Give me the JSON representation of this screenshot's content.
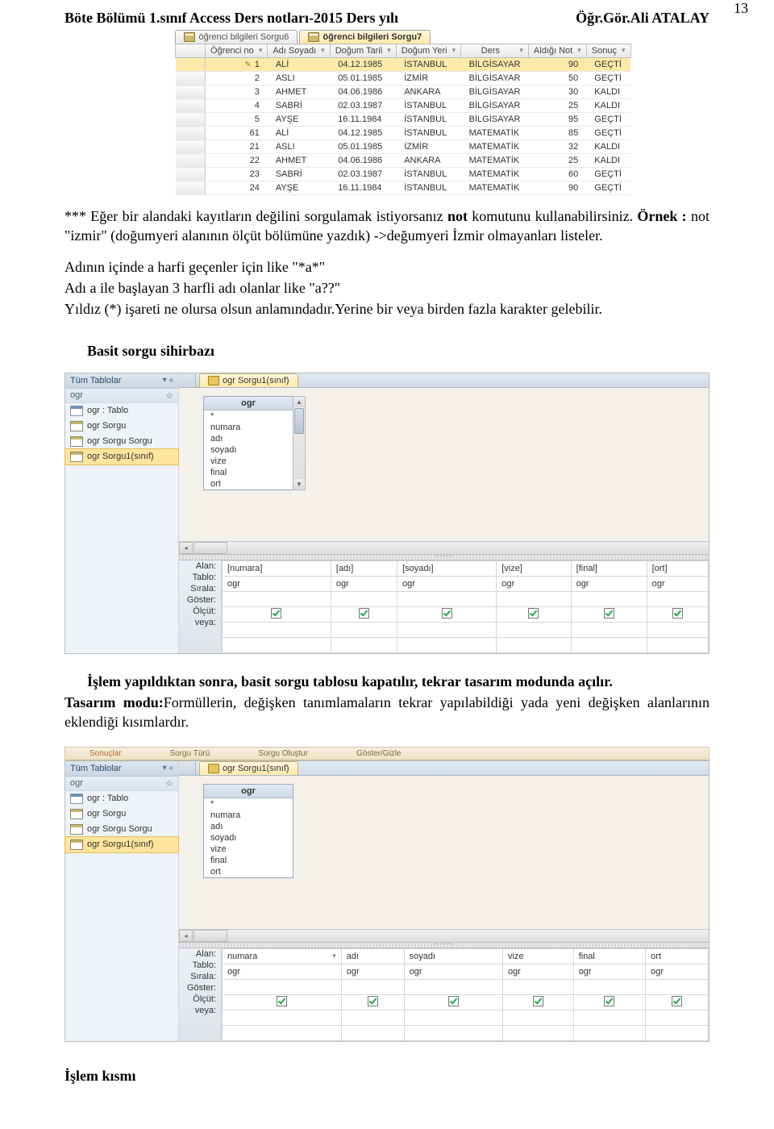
{
  "page_number": "13",
  "header_left": "Böte Bölümü 1.sınıf Access Ders notları-2015 Ders yılı",
  "header_right": "Öğr.Gör.Ali ATALAY",
  "query_tabs": [
    "öğrenci bilgileri Sorgu6",
    "öğrenci bilgileri Sorgu7"
  ],
  "qres_headers": [
    "Öğrenci no",
    "Adı Soyadı",
    "Doğum Taril",
    "Doğum Yeri",
    "Ders",
    "Aldığı Not",
    "Sonuç"
  ],
  "qres_rows": [
    [
      "1",
      "ALİ",
      "04.12.1985",
      "İSTANBUL",
      "BİLGİSAYAR",
      "90",
      "GEÇTİ"
    ],
    [
      "2",
      "ASLI",
      "05.01.1985",
      "İZMİR",
      "BİLGİSAYAR",
      "50",
      "GEÇTİ"
    ],
    [
      "3",
      "AHMET",
      "04.06.1986",
      "ANKARA",
      "BİLGİSAYAR",
      "30",
      "KALDI"
    ],
    [
      "4",
      "SABRİ",
      "02.03.1987",
      "İSTANBUL",
      "BİLGİSAYAR",
      "25",
      "KALDI"
    ],
    [
      "5",
      "AYŞE",
      "16.11.1984",
      "İSTANBUL",
      "BİLGİSAYAR",
      "95",
      "GEÇTİ"
    ],
    [
      "61",
      "ALİ",
      "04.12.1985",
      "İSTANBUL",
      "MATEMATİK",
      "85",
      "GEÇTİ"
    ],
    [
      "21",
      "ASLI",
      "05.01.1985",
      "İZMİR",
      "MATEMATİK",
      "32",
      "KALDI"
    ],
    [
      "22",
      "AHMET",
      "04.06.1986",
      "ANKARA",
      "MATEMATİK",
      "25",
      "KALDI"
    ],
    [
      "23",
      "SABRİ",
      "02.03.1987",
      "İSTANBUL",
      "MATEMATİK",
      "60",
      "GEÇTİ"
    ],
    [
      "24",
      "AYŞE",
      "16.11.1984",
      "İSTANBUL",
      "MATEMATİK",
      "90",
      "GEÇTİ"
    ]
  ],
  "para1": "*** Eğer bir alandaki kayıtların değilini sorgulamak istiyorsanız ",
  "para1_bold": "not",
  "para1b": " komutunu kullanabilirsiniz. ",
  "para1_bold2": "Örnek :",
  "para1c": " not \"izmir\" (doğumyeri alanının ölçüt  bölümüne yazdık) ->değumyeri İzmir olmayanları listeler.",
  "para2": "Adının içinde a harfi geçenler için like \"*a*\"",
  "para3": "Adı a ile başlayan 3 harfli adı olanlar   like \"a??\"",
  "para4": "Yıldız (*) işareti ne olursa olsun anlamındadır.Yerine bir veya birden fazla karakter gelebilir.",
  "heading_basit": "Basit sorgu sihirbazı",
  "nav_title": "Tüm Tablolar",
  "nav_group": "ogr",
  "nav_items": [
    "ogr : Tablo",
    "ogr Sorgu",
    "ogr Sorgu Sorgu",
    "ogr Sorgu1(sınıf)"
  ],
  "query_tab_design": "ogr Sorgu1(sınıf)",
  "tbl_box_title": "ogr",
  "tbl_box_fields": [
    "*",
    "numara",
    "adı",
    "soyadı",
    "vize",
    "final",
    "ort"
  ],
  "grid_labels": [
    "Alan:",
    "Tablo:",
    "Sırala:",
    "Göster:",
    "Ölçüt:",
    "veya:"
  ],
  "grid1_alan": [
    "[numara]",
    "[adı]",
    "[soyadı]",
    "[vize]",
    "[final]",
    "[ort]"
  ],
  "grid2_alan": [
    "numara",
    "adı",
    "soyadı",
    "vize",
    "final",
    "ort"
  ],
  "grid_tablo": "ogr",
  "para_after1": "İşlem yapıldıktan sonra, basit sorgu tablosu kapatılır, tekrar tasarım modunda açılır.",
  "para_after2a": "Tasarım modu:",
  "para_after2b": "Formüllerin, değişken tanımlamaların tekrar yapılabildiği yada yeni değişken alanlarının eklendiği kısımlardır.",
  "ribbon_items": [
    "Sonuçlar",
    "Sorgu Türü",
    "Sorgu Oluştur",
    "Göster/Gizle"
  ],
  "footer": "İşlem kısmı"
}
